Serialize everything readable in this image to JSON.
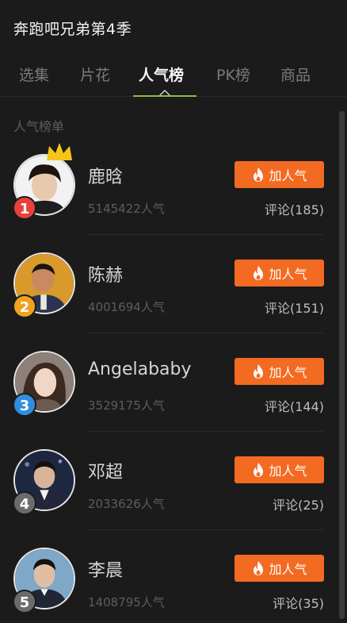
{
  "header": {
    "title": "奔跑吧兄弟第4季"
  },
  "tabs": [
    {
      "label": "选集",
      "active": false
    },
    {
      "label": "片花",
      "active": false
    },
    {
      "label": "人气榜",
      "active": true
    },
    {
      "label": "PK榜",
      "active": false
    },
    {
      "label": "商品",
      "active": false
    }
  ],
  "section": {
    "label": "人气榜单"
  },
  "colors": {
    "accent": "#f36a22",
    "tab_indicator": "#8ac03b",
    "rank1": "#e8413b",
    "rank2": "#f0a11e",
    "rank3": "#2f8ee0",
    "rank_other": "#6b6b6b",
    "crown": "#f5c518"
  },
  "ranking": [
    {
      "rank": "1",
      "name": "鹿晗",
      "popularity": "5145422人气",
      "button": "加人气",
      "comments": "评论(185)",
      "crown": true,
      "avatar": "avatar-1"
    },
    {
      "rank": "2",
      "name": "陈赫",
      "popularity": "4001694人气",
      "button": "加人气",
      "comments": "评论(151)",
      "crown": false,
      "avatar": "avatar-2"
    },
    {
      "rank": "3",
      "name": "Angelababy",
      "popularity": "3529175人气",
      "button": "加人气",
      "comments": "评论(144)",
      "crown": false,
      "avatar": "avatar-3"
    },
    {
      "rank": "4",
      "name": "邓超",
      "popularity": "2033626人气",
      "button": "加人气",
      "comments": "评论(25)",
      "crown": false,
      "avatar": "avatar-4"
    },
    {
      "rank": "5",
      "name": "李晨",
      "popularity": "1408795人气",
      "button": "加人气",
      "comments": "评论(35)",
      "crown": false,
      "avatar": "avatar-5"
    }
  ]
}
